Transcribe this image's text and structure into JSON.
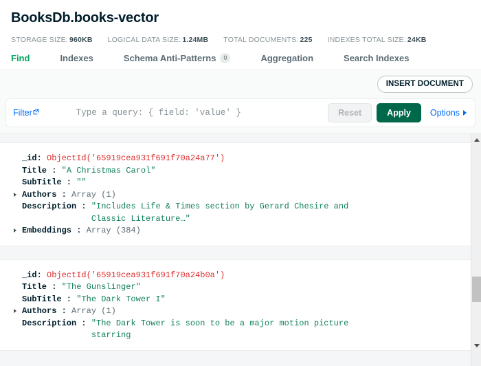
{
  "collection": {
    "title": "BooksDb.books-vector"
  },
  "stats": [
    {
      "label": "STORAGE SIZE:",
      "value": "960KB",
      "name": "storage-size"
    },
    {
      "label": "LOGICAL DATA SIZE:",
      "value": "1.24MB",
      "name": "logical-data-size"
    },
    {
      "label": "TOTAL DOCUMENTS:",
      "value": "225",
      "name": "total-documents"
    },
    {
      "label": "INDEXES TOTAL SIZE:",
      "value": "24KB",
      "name": "indexes-total-size"
    }
  ],
  "tabs": [
    {
      "label": "Find",
      "active": true,
      "badge": null
    },
    {
      "label": "Indexes",
      "active": false,
      "badge": null
    },
    {
      "label": "Schema Anti-Patterns",
      "active": false,
      "badge": "0"
    },
    {
      "label": "Aggregation",
      "active": false,
      "badge": null
    },
    {
      "label": "Search Indexes",
      "active": false,
      "badge": null
    }
  ],
  "toolbar": {
    "insert_document_label": "INSERT DOCUMENT"
  },
  "querybar": {
    "filter_label": "Filter",
    "query_value": "",
    "query_placeholder": "Type a query: { field: 'value' }",
    "reset_label": "Reset",
    "apply_label": "Apply",
    "options_label": "Options"
  },
  "colors": {
    "accent_green": "#00a35c",
    "apply_green": "#00684a",
    "link_blue": "#016bf8",
    "objectid_red": "#db3030",
    "string_green": "#12805c"
  },
  "documents": [
    {
      "fields": [
        {
          "key": "_id",
          "sep": ": ",
          "value": "ObjectId('65919cea931f691f70a24a77')",
          "type": "objectid",
          "expandable": false
        },
        {
          "key": "Title",
          "sep": " : ",
          "value": "\"A Christmas Carol\"",
          "type": "string",
          "expandable": false
        },
        {
          "key": "SubTitle",
          "sep": " : ",
          "value": "\"\"",
          "type": "string",
          "expandable": false
        },
        {
          "key": "Authors",
          "sep": " : ",
          "value": "Array (1)",
          "type": "array",
          "expandable": true
        },
        {
          "key": "Description",
          "sep": " : ",
          "value": "\"Includes Life & Times section by Gerard Chesire and Classic Literature…\"",
          "type": "string",
          "expandable": false
        },
        {
          "key": "Embeddings",
          "sep": " : ",
          "value": "Array (384)",
          "type": "array",
          "expandable": true
        }
      ]
    },
    {
      "fields": [
        {
          "key": "_id",
          "sep": ": ",
          "value": "ObjectId('65919cea931f691f70a24b0a')",
          "type": "objectid",
          "expandable": false
        },
        {
          "key": "Title",
          "sep": " : ",
          "value": "\"The Gunslinger\"",
          "type": "string",
          "expandable": false
        },
        {
          "key": "SubTitle",
          "sep": " : ",
          "value": "\"The Dark Tower I\"",
          "type": "string",
          "expandable": false
        },
        {
          "key": "Authors",
          "sep": " : ",
          "value": "Array (1)",
          "type": "array",
          "expandable": true
        },
        {
          "key": "Description",
          "sep": " : ",
          "value": "\"The Dark Tower is soon to be a major motion picture starring",
          "type": "string",
          "expandable": false
        }
      ]
    }
  ],
  "scrollbar": {
    "up_arrow": "scroll-up",
    "down_arrow": "scroll-down"
  }
}
